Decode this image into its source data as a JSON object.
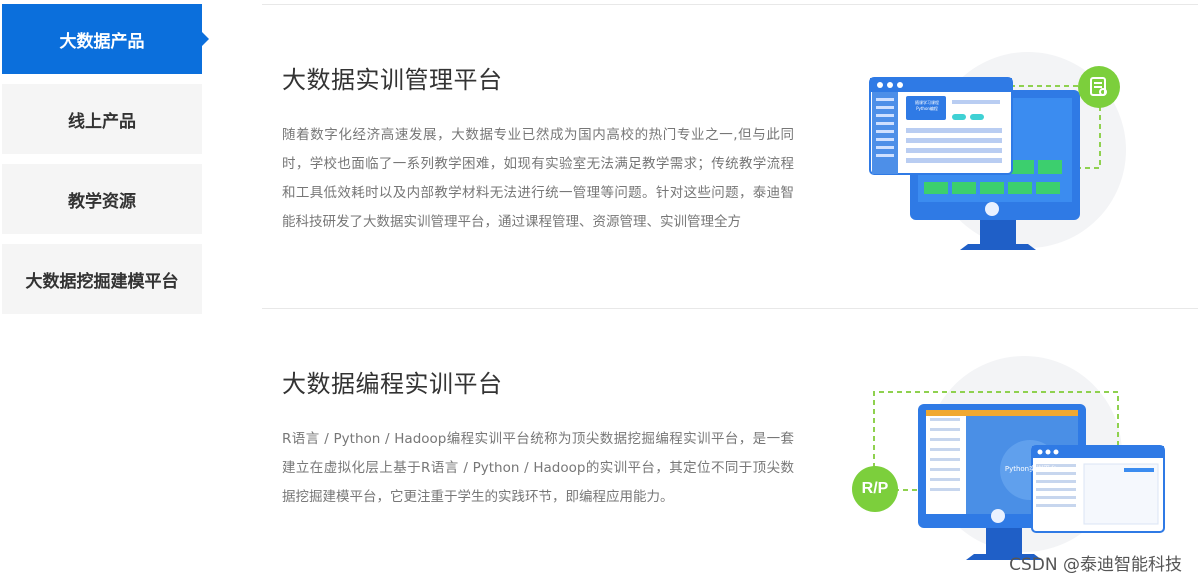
{
  "sidebar": {
    "items": [
      {
        "label": "大数据产品",
        "active": true
      },
      {
        "label": "线上产品",
        "active": false
      },
      {
        "label": "教学资源",
        "active": false
      },
      {
        "label": "大数据挖掘建模平台",
        "active": false
      }
    ]
  },
  "sections": [
    {
      "title": "大数据实训管理平台",
      "description": "随着数字化经济高速发展，大数据专业已然成为国内高校的热门专业之一,但与此同时，学校也面临了一系列教学困难，如现有实验室无法满足教学需求；传统教学流程和工具低效耗时以及内部教学材料无法进行统一管理等问题。针对这些问题，泰迪智能科技研发了大数据实训管理平台，通过课程管理、资源管理、实训管理全方",
      "illustration": {
        "screen_caption": "Python编程",
        "screen_heading": "随课学习课程"
      }
    },
    {
      "title": "大数据编程实训平台",
      "description": "R语言 / Python / Hadoop编程实训平台统称为顶尖数据挖掘编程实训平台，是一套建立在虚拟化层上基于R语言 / Python / Hadoop的实训平台，其定位不同于顶尖数据挖掘建模平台，它更注重于学生的实践环节，即编程应用能力。",
      "illustration": {
        "badge": "R/P",
        "screen_caption": "Python实训平台"
      }
    }
  ],
  "watermark": "CSDN @泰迪智能科技",
  "colors": {
    "primary": "#0b6fdc",
    "accent_green": "#7ccf3c",
    "sidebar_bg": "#f5f5f5"
  }
}
